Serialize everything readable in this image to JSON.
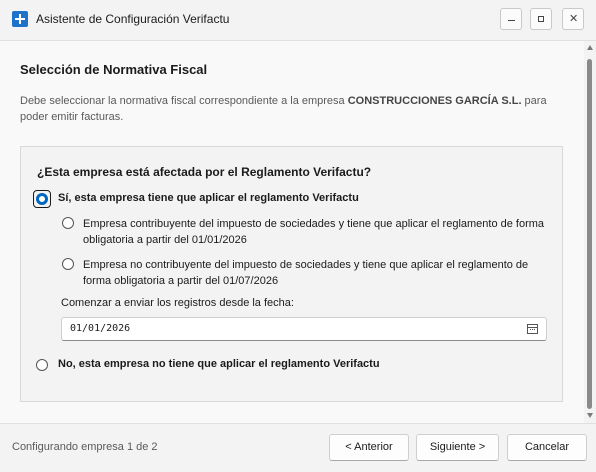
{
  "window": {
    "title": "Asistente de Configuración Verifactu",
    "controls": {
      "minimize": "−",
      "maximize": "□",
      "close": "✕"
    }
  },
  "page": {
    "heading": "Selección de Normativa Fiscal",
    "description_prefix": "Debe seleccionar la normativa fiscal correspondiente a la empresa ",
    "company": "CONSTRUCCIONES GARCÍA S.L.",
    "description_suffix": " para poder emitir facturas."
  },
  "panel": {
    "question": "¿Esta empresa está afectada por el Reglamento Verifactu?",
    "option_yes": {
      "label": "Sí, esta empresa tiene que aplicar el reglamento Verifactu",
      "selected": true
    },
    "sub_option_1": {
      "label": "Empresa contribuyente del impuesto de sociedades y tiene que aplicar el reglamento de forma obligatoria a partir del 01/01/2026",
      "selected": false
    },
    "sub_option_2": {
      "label": "Empresa no contribuyente del impuesto de sociedades y tiene que aplicar el reglamento de forma obligatoria a partir del 01/07/2026",
      "selected": false
    },
    "date_label": "Comenzar a enviar los registros desde la fecha:",
    "date_value": "01/01/2026",
    "option_no": {
      "label": "No, esta empresa no tiene que aplicar el reglamento Verifactu",
      "selected": false
    }
  },
  "footer": {
    "status": "Configurando empresa 1 de 2",
    "back_label": "< Anterior",
    "next_label": "Siguiente >",
    "cancel_label": "Cancelar"
  },
  "colors": {
    "accent": "#0067c0",
    "window_bg": "#f3f3f3",
    "content_bg": "#f9f9f9"
  },
  "icons": {
    "app": "app-logo-icon",
    "calendar": "calendar-icon"
  }
}
